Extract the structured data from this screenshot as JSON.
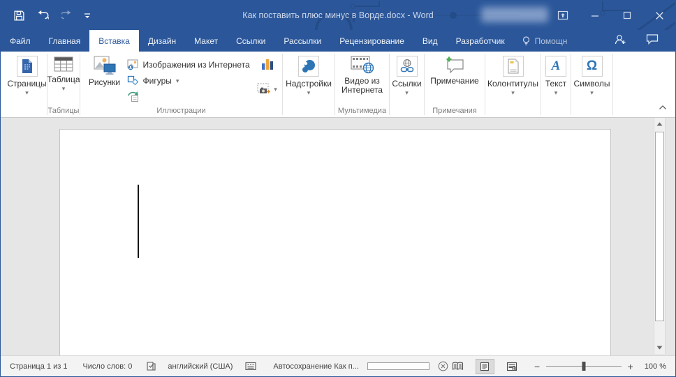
{
  "colors": {
    "accent": "#2b579a"
  },
  "title_bar": {
    "title": "Как поставить плюс минус в Ворде.docx - Word"
  },
  "tabs": [
    {
      "label": "Файл"
    },
    {
      "label": "Главная"
    },
    {
      "label": "Вставка"
    },
    {
      "label": "Дизайн"
    },
    {
      "label": "Макет"
    },
    {
      "label": "Ссылки"
    },
    {
      "label": "Рассылки"
    },
    {
      "label": "Рецензирование"
    },
    {
      "label": "Вид"
    },
    {
      "label": "Разработчик"
    }
  ],
  "active_tab": "Вставка",
  "help_tab": {
    "label": "Помощн"
  },
  "ribbon": {
    "pages_button": "Страницы",
    "table_button": "Таблица",
    "tables_group": "Таблицы",
    "pictures_button": "Рисунки",
    "online_pictures_button": "Изображения из Интернета",
    "shapes_button": "Фигуры",
    "illustrations_group": "Иллюстрации",
    "addins_button": "Надстройки",
    "video_line1": "Видео из",
    "video_line2": "Интернета",
    "multimedia_group": "Мультимедиа",
    "links_button": "Ссылки",
    "comment_button": "Примечание",
    "comments_group": "Примечания",
    "header_footer_button": "Колонтитулы",
    "text_button": "Текст",
    "symbols_button": "Символы"
  },
  "status_bar": {
    "page_indicator": "Страница 1 из 1",
    "word_count": "Число слов: 0",
    "language": "английский (США)",
    "autosave": "Автосохранение Как п...",
    "zoom_level": "100 %"
  },
  "icons": {
    "dropdown": "▾",
    "text_a": "A",
    "omega": "Ω",
    "zoom_out": "−",
    "zoom_in": "+"
  }
}
